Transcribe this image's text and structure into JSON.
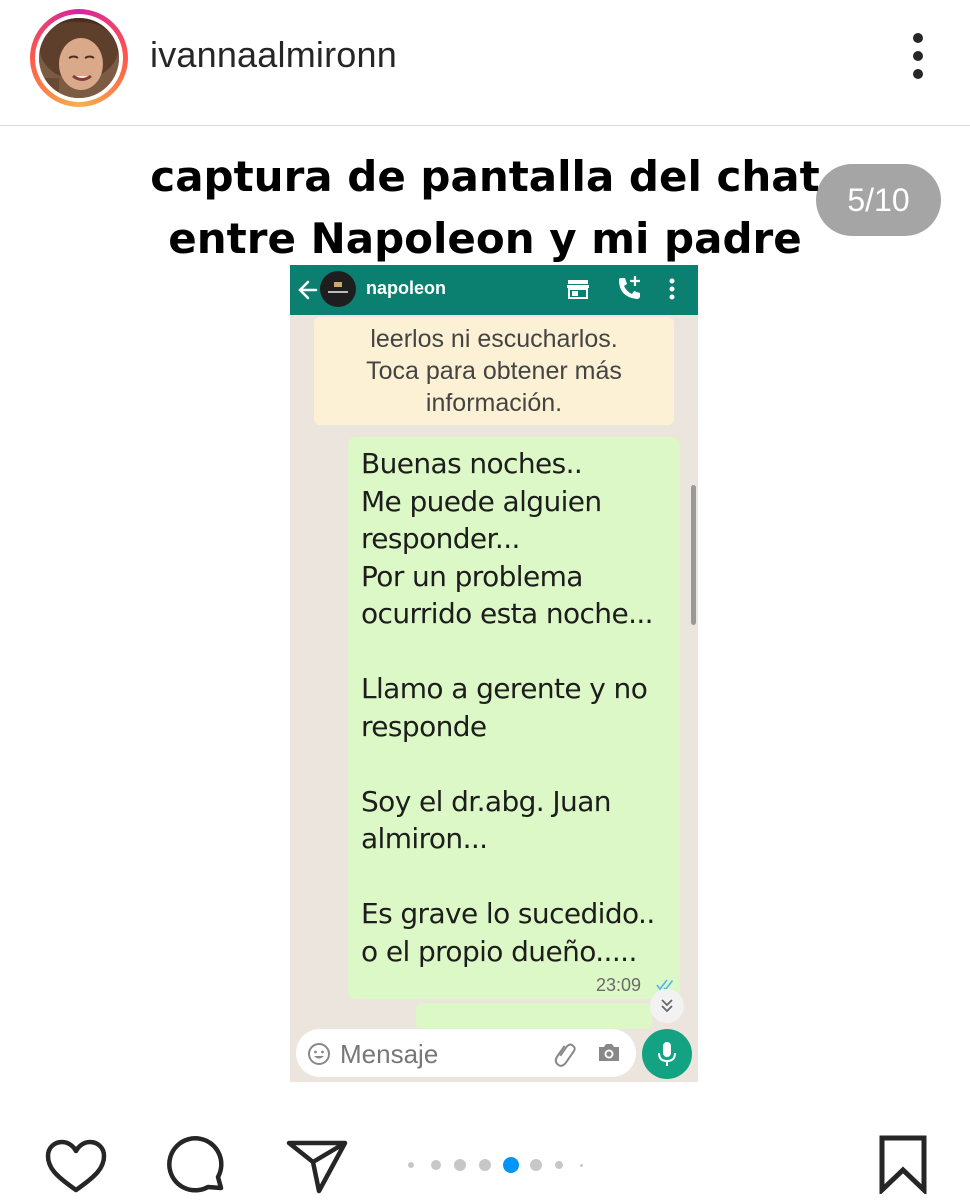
{
  "header": {
    "username": "ivannaalmironn",
    "avatar_icon": "profile-photo",
    "more_icon": "vertical-dots-icon"
  },
  "post": {
    "title_line1": "captura de pantalla del chat",
    "title_line2": "entre Napoleon y mi padre",
    "counter": "5/10"
  },
  "chat": {
    "contact_name": "napoleon",
    "header_color": "#0c8070",
    "notice_lines": [
      "leerlos ni escucharlos.",
      "Toca para obtener más",
      "información."
    ],
    "message_lines": [
      "Buenas noches..",
      "Me puede alguien",
      "responder...",
      "Por un problema",
      "ocurrido esta noche...",
      "",
      "Llamo a gerente y no",
      "responde",
      "",
      "Soy el dr.abg. Juan",
      "almiron...",
      "",
      "Es grave lo sucedido..",
      "o el propio dueño....."
    ],
    "message_time": "23:09",
    "input_placeholder": "Mensaje",
    "bubble_color": "#dcf8c6",
    "mic_color": "#13a382"
  },
  "actions": {
    "icons": [
      "heart-icon",
      "comment-icon",
      "share-icon",
      "bookmark-icon"
    ]
  },
  "carousel": {
    "total_dots_visible": 7,
    "active_dot_index": 4,
    "active_color": "#0095f6"
  }
}
